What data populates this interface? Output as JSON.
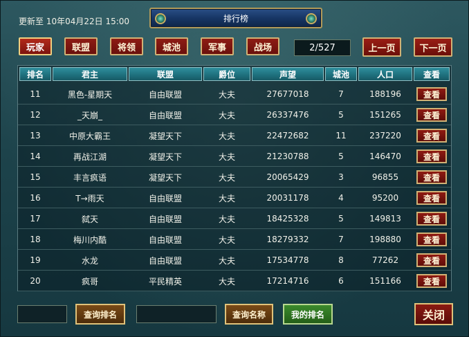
{
  "header": {
    "updated_label": "更新至",
    "updated_value": "10年04月22日 15:00",
    "title": "排行榜"
  },
  "tabs": [
    {
      "label": "玩家",
      "active": true
    },
    {
      "label": "联盟",
      "active": false
    },
    {
      "label": "将领",
      "active": false
    },
    {
      "label": "城池",
      "active": false
    },
    {
      "label": "军事",
      "active": false
    },
    {
      "label": "战场",
      "active": false
    }
  ],
  "pager": {
    "display": "2/527",
    "prev_label": "上一页",
    "next_label": "下一页"
  },
  "table": {
    "columns": [
      "排名",
      "君主",
      "联盟",
      "爵位",
      "声望",
      "城池",
      "人口",
      "查看"
    ],
    "view_label": "查看",
    "rows": [
      {
        "rank": "11",
        "lord": "黑色-星期天",
        "alliance": "自由联盟",
        "title": "大夫",
        "prestige": "27677018",
        "cities": "7",
        "population": "188196"
      },
      {
        "rank": "12",
        "lord": "_天崩_",
        "alliance": "自由联盟",
        "title": "大夫",
        "prestige": "26337476",
        "cities": "5",
        "population": "151265"
      },
      {
        "rank": "13",
        "lord": "中原大霸王",
        "alliance": "凝望天下",
        "title": "大夫",
        "prestige": "22472682",
        "cities": "11",
        "population": "237220"
      },
      {
        "rank": "14",
        "lord": "再战江湖",
        "alliance": "凝望天下",
        "title": "大夫",
        "prestige": "21230788",
        "cities": "5",
        "population": "146470"
      },
      {
        "rank": "15",
        "lord": "丰言疯语",
        "alliance": "凝望天下",
        "title": "大夫",
        "prestige": "20065429",
        "cities": "3",
        "population": "96855"
      },
      {
        "rank": "16",
        "lord": "T→雨天",
        "alliance": "自由联盟",
        "title": "大夫",
        "prestige": "20031178",
        "cities": "4",
        "population": "95200"
      },
      {
        "rank": "17",
        "lord": "弑天",
        "alliance": "自由联盟",
        "title": "大夫",
        "prestige": "18425328",
        "cities": "5",
        "population": "149813"
      },
      {
        "rank": "18",
        "lord": "梅川内酷",
        "alliance": "自由联盟",
        "title": "大夫",
        "prestige": "18279332",
        "cities": "7",
        "population": "198880"
      },
      {
        "rank": "19",
        "lord": "水龙",
        "alliance": "自由联盟",
        "title": "大夫",
        "prestige": "17534778",
        "cities": "8",
        "population": "77262"
      },
      {
        "rank": "20",
        "lord": "疯哥",
        "alliance": "平民精英",
        "title": "大夫",
        "prestige": "17214716",
        "cities": "6",
        "population": "151166"
      }
    ]
  },
  "footer": {
    "query_rank_label": "查询排名",
    "query_name_label": "查询名称",
    "my_rank_label": "我的排名",
    "close_label": "关闭"
  }
}
